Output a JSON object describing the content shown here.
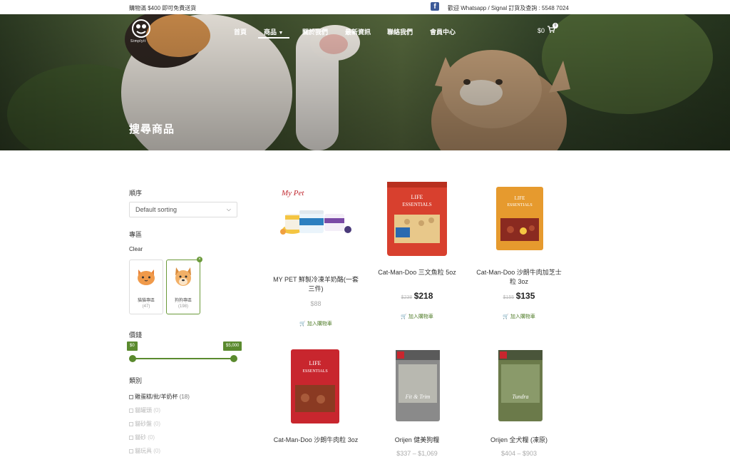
{
  "topbar": {
    "left_text": "購物滿 $400 即可免費送貨",
    "right_text": "歡迎 Whatsapp / Signal 訂貨及查詢 : 5548 7024"
  },
  "header": {
    "logo_text": "Simplyit",
    "nav": [
      {
        "label": "首頁"
      },
      {
        "label": "商品"
      },
      {
        "label": "關於我們"
      },
      {
        "label": "最新資訊"
      },
      {
        "label": "聯絡我們"
      },
      {
        "label": "會員中心"
      }
    ],
    "cart_total": "$0",
    "cart_count": "0"
  },
  "page_title": "搜尋商品",
  "sidebar": {
    "sort_heading": "順序",
    "sort_value": "Default sorting",
    "zone_heading": "專區",
    "clear_label": "Clear",
    "zones": [
      {
        "label": "貓貓專區",
        "count": "(47)"
      },
      {
        "label": "狗狗專區",
        "count": "(198)"
      }
    ],
    "price_heading": "價錢",
    "price_min": "$0",
    "price_max": "$5,000",
    "category_heading": "類別",
    "categories": [
      {
        "label": "雞蛋糕/批/羊奶杯",
        "count": "(18)"
      },
      {
        "label": "貓罐頭",
        "count": "(0)"
      },
      {
        "label": "貓砂盤",
        "count": "(0)"
      },
      {
        "label": "貓砂",
        "count": "(0)"
      },
      {
        "label": "貓玩具",
        "count": "(0)"
      }
    ]
  },
  "products": [
    {
      "name": "MY PET 鮮製冷凍羊奶酪(一套三件)",
      "price": "$88",
      "old_price": "",
      "add_label": "加入購物車"
    },
    {
      "name": "Cat-Man-Doo 三文魚粒 5oz",
      "price": "$218",
      "old_price": "$238",
      "add_label": "加入購物車"
    },
    {
      "name": "Cat-Man-Doo 沙朗牛肉加芝士粒 3oz",
      "price": "$135",
      "old_price": "$155",
      "add_label": "加入購物車"
    },
    {
      "name": "Cat-Man-Doo 沙朗牛肉粒 3oz",
      "price": "",
      "old_price": "",
      "add_label": ""
    },
    {
      "name": "Orijen 健美狗糧",
      "price": "$337 – $1,069",
      "old_price": "",
      "add_label": ""
    },
    {
      "name": "Orijen 全犬糧 (凍原)",
      "price": "$404 – $903",
      "old_price": "",
      "add_label": ""
    }
  ],
  "colors": {
    "accent_green": "#5a8a2e",
    "hero_overlay": "#3d4d2c"
  }
}
